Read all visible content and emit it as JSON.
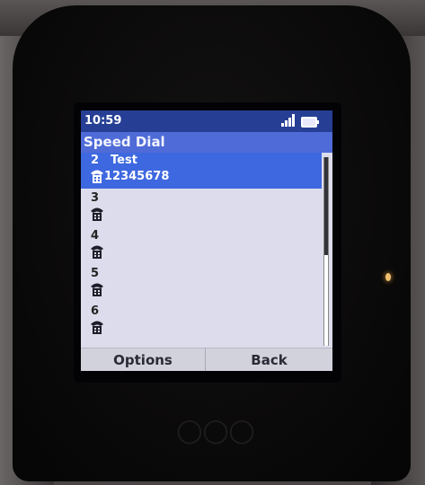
{
  "status": {
    "time": "10:59"
  },
  "screen": {
    "title": "Speed Dial"
  },
  "entries": [
    {
      "number": "2",
      "name": "Test",
      "phone": "12345678",
      "selected": true
    },
    {
      "number": "3",
      "name": "",
      "phone": "",
      "selected": false
    },
    {
      "number": "4",
      "name": "",
      "phone": "",
      "selected": false
    },
    {
      "number": "5",
      "name": "",
      "phone": "",
      "selected": false
    },
    {
      "number": "6",
      "name": "",
      "phone": "",
      "selected": false
    }
  ],
  "softkeys": {
    "left": "Options",
    "right": "Back"
  },
  "scroll": {
    "position_fraction": 0.0,
    "visible_fraction": 0.52
  },
  "colors": {
    "status_bar": "#263f95",
    "title_bar": "#4f6bd7",
    "selected_row": "#3e68e0",
    "list_background": "#dcdcec",
    "led": "#f0c070"
  },
  "icons": [
    "signal-bars-icon",
    "battery-icon",
    "phone-handset-icon"
  ]
}
